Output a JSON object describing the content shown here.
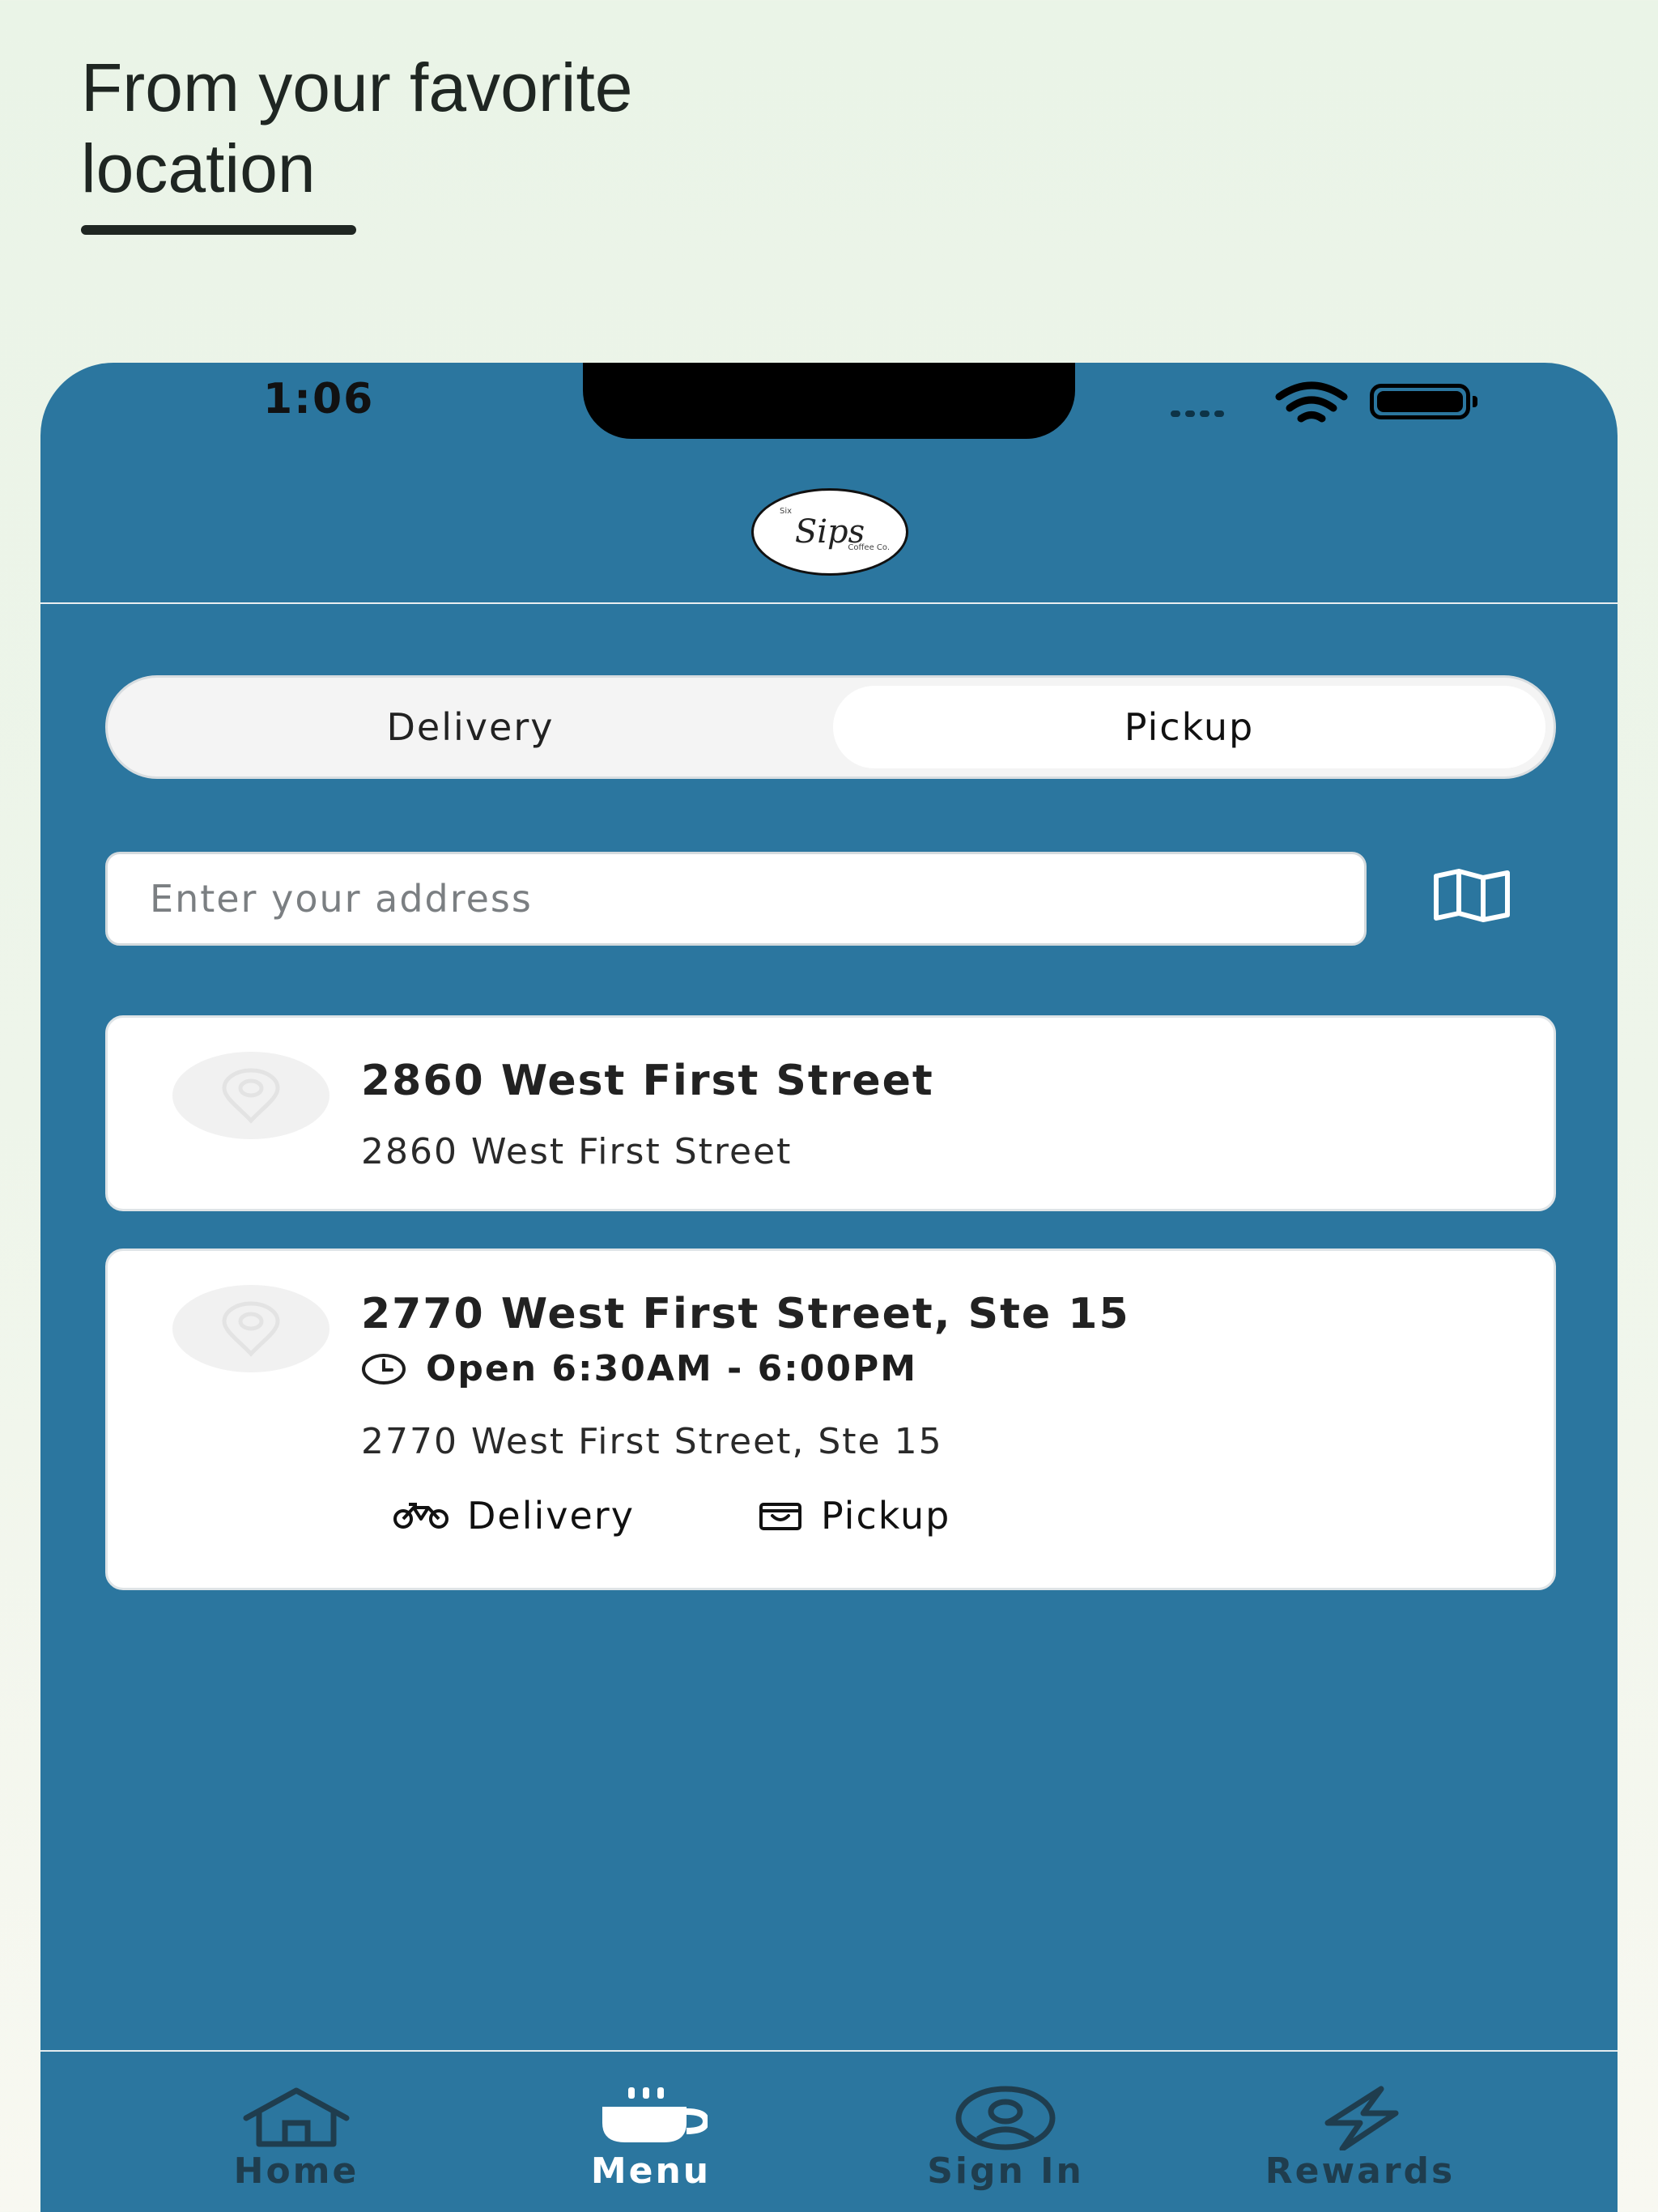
{
  "headline": {
    "text": "From your favorite location"
  },
  "status_bar": {
    "time": "1:06"
  },
  "brand": {
    "logo_text": "Sips",
    "logo_top": "Six",
    "logo_bottom": "Coffee Co."
  },
  "order_mode": {
    "options": [
      {
        "label": "Delivery",
        "selected": false
      },
      {
        "label": "Pickup",
        "selected": true
      }
    ]
  },
  "search": {
    "placeholder": "Enter your address",
    "value": ""
  },
  "locations": [
    {
      "name": "2860 West First Street",
      "address": "2860 West First Street"
    },
    {
      "name": "2770 West First Street, Ste 15",
      "hours": "Open 6:30AM - 6:00PM",
      "address": "2770 West First Street, Ste 15",
      "services": [
        "Delivery",
        "Pickup"
      ]
    }
  ],
  "tabbar": {
    "items": [
      {
        "label": "Home",
        "icon": "home-icon"
      },
      {
        "label": "Menu",
        "icon": "coffee-cup-icon",
        "active": true
      },
      {
        "label": "Sign In",
        "icon": "user-icon"
      },
      {
        "label": "Rewards",
        "icon": "lightning-icon"
      }
    ]
  },
  "colors": {
    "primary": "#2b769f",
    "page_bg": "#eaf4e7",
    "text_dark": "#222222",
    "tab_inactive": "#1f3d4e"
  }
}
